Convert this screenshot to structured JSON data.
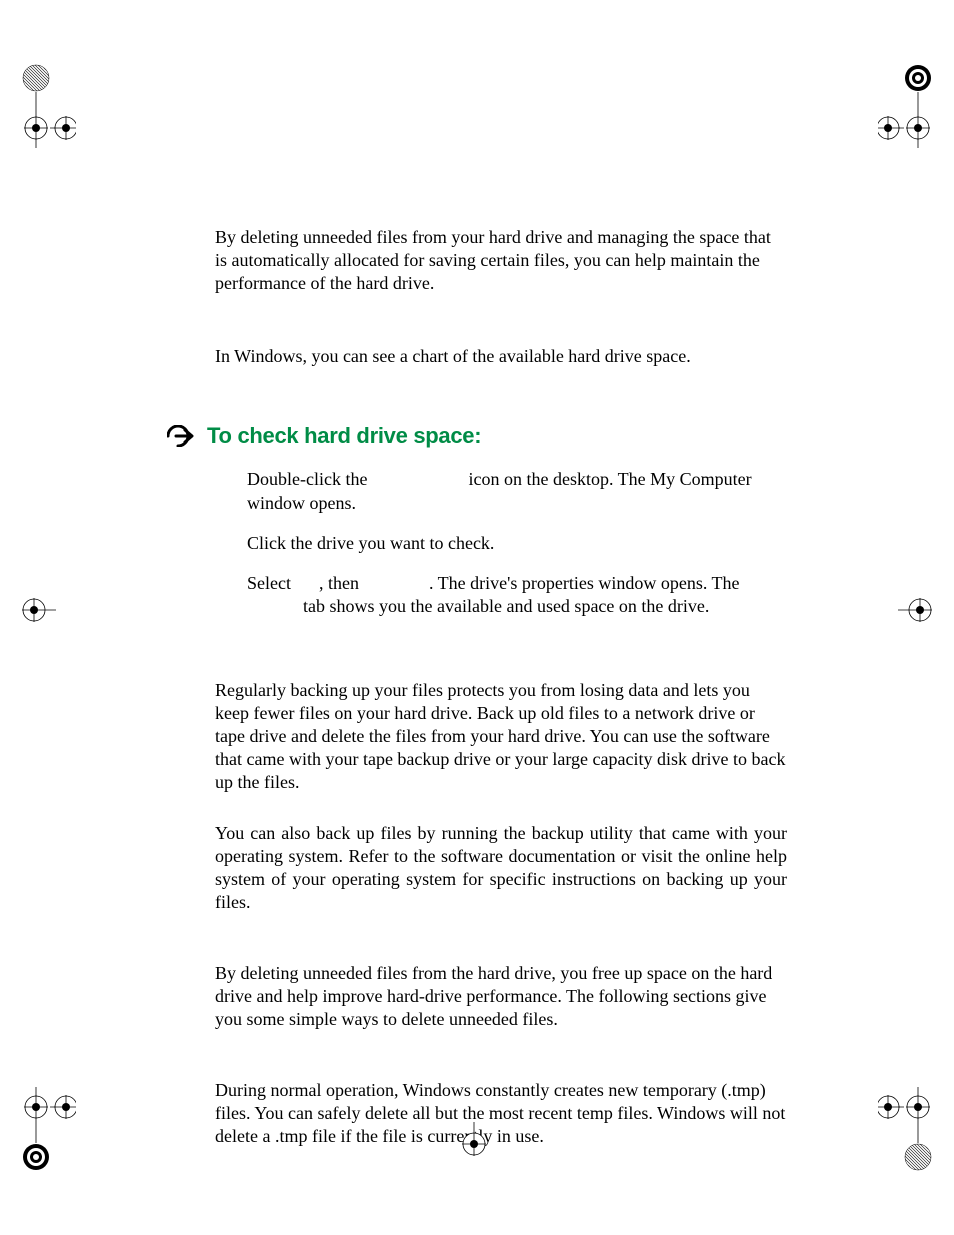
{
  "para1": "By deleting unneeded files from your hard drive and managing the space that is automatically allocated for saving certain files, you can help maintain the performance of the hard drive.",
  "para2": "In Windows, you can see a chart of the available hard drive space.",
  "heading": "To check hard drive space:",
  "step1a": "Double-click the ",
  "step1b": " icon on the desktop. The My Computer window opens.",
  "step2": "Click the drive you want to check.",
  "step3a": "Select",
  "step3b": ", then",
  "step3c": ". The drive's properties window opens. The",
  "step3d": "tab shows you the available and used space on the drive.",
  "para3": "Regularly backing up your files protects you from losing data and lets you keep fewer files on your hard drive. Back up old files to a network drive or tape drive and delete the files from your hard drive. You can use the software that came with your tape backup drive or your large capacity disk drive to back up the files.",
  "para4": "You can also back up files by running the backup utility that came with your operating system. Refer to the software documentation or visit the online help system of your operating system for specific instructions on backing up your files.",
  "para5": "By deleting unneeded files from the hard drive, you free up space on the hard drive and help improve hard-drive performance. The following sections give you some simple ways to delete unneeded files.",
  "para6": "During normal operation, Windows constantly creates new temporary (.tmp) files. You can safely delete all but the most recent temp files. Windows will not delete a .tmp file if the file is currently in use."
}
